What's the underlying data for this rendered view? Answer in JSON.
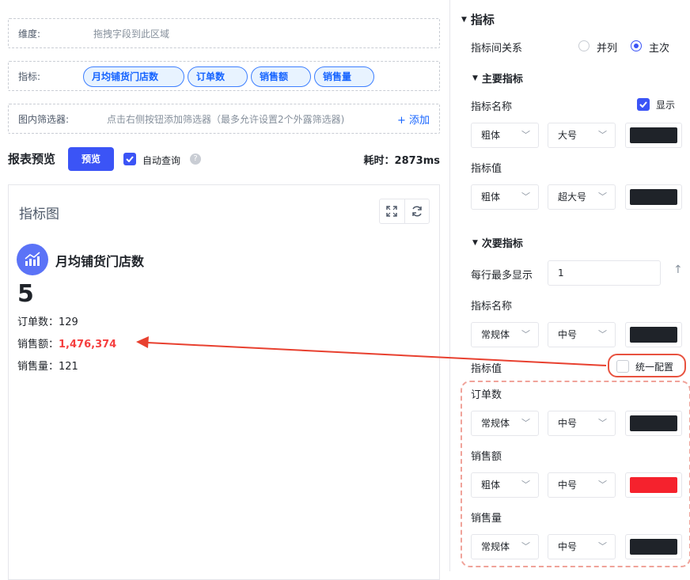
{
  "dimension": {
    "label": "维度:",
    "hint": "拖拽字段到此区域"
  },
  "metrics": {
    "label": "指标:",
    "pills": [
      "月均铺货门店数",
      "订单数",
      "销售额",
      "销售量"
    ]
  },
  "filters": {
    "label": "图内筛选器:",
    "hint": "点击右侧按钮添加筛选器（最多允许设置2个外露筛选器)",
    "add": "添加",
    "add_icon": "plus-icon"
  },
  "toolbar": {
    "title": "报表预览",
    "preview": "预览",
    "auto_query": "自动查询",
    "help": "?",
    "timing": "耗时：2873ms"
  },
  "card": {
    "title": "指标图",
    "main_metric": {
      "name": "月均铺货门店数",
      "value": "5"
    },
    "rows": [
      {
        "label": "订单数：",
        "value": "129"
      },
      {
        "label": "销售额：",
        "value": "1,476,374",
        "color": "#f53f3f"
      },
      {
        "label": "销售量：",
        "value": "121"
      }
    ]
  },
  "panel": {
    "section": "指标",
    "relation": {
      "label": "指标间关系",
      "options": [
        "并列",
        "主次"
      ],
      "selected": "主次"
    },
    "primary": {
      "title": "主要指标",
      "name_label": "指标名称",
      "show_label": "显示",
      "name_weight": "粗体",
      "name_size": "大号",
      "name_color": "#1f2329",
      "value_label": "指标值",
      "value_weight": "粗体",
      "value_size": "超大号",
      "value_color": "#1f2329"
    },
    "secondary": {
      "title": "次要指标",
      "per_row_label": "每行最多显示",
      "per_row_value": "1",
      "name_label": "指标名称",
      "name_weight": "常规体",
      "name_size": "中号",
      "name_color": "#1f2329",
      "value_label": "指标值",
      "unify_label": "统一配置",
      "items": [
        {
          "label": "订单数",
          "weight": "常规体",
          "size": "中号",
          "color": "#1f2329"
        },
        {
          "label": "销售额",
          "weight": "粗体",
          "size": "中号",
          "color": "#f5222d"
        },
        {
          "label": "销售量",
          "weight": "常规体",
          "size": "中号",
          "color": "#1f2329"
        }
      ]
    }
  }
}
